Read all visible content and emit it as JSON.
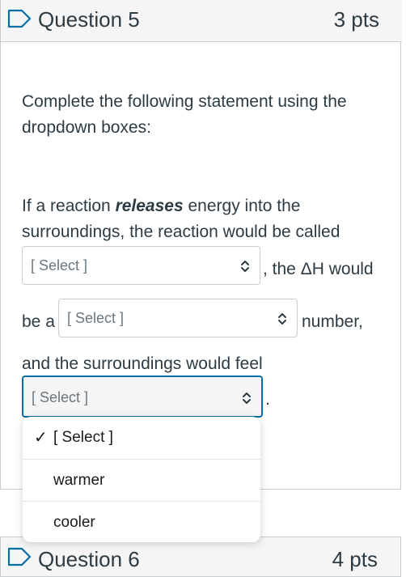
{
  "question5": {
    "title": "Question 5",
    "points": "3 pts",
    "instruction_line1": "Complete the following statement using the",
    "instruction_line2": "dropdown boxes:",
    "stmt_prefix": "If a reaction ",
    "stmt_bold": "releases",
    "stmt_suffix": " energy into the",
    "line2": "surroundings, the reaction would be called",
    "after_select1": ", the ΔH would",
    "be_a": "be a",
    "after_select2": "number,",
    "line5": "and the surroundings would feel",
    "after_select3": ".",
    "select1": {
      "value": "[ Select ]"
    },
    "select2": {
      "value": "[ Select ]"
    },
    "select3": {
      "value": "[ Select ]"
    }
  },
  "dropdown": {
    "check": "✓",
    "options": [
      "[ Select ]",
      "warmer",
      "cooler"
    ],
    "selected_index": 0
  },
  "question6": {
    "title": "Question 6",
    "points": "4 pts"
  },
  "colors": {
    "accent": "#0770a3",
    "text": "#2d3b45",
    "border": "#c7cdd1",
    "header_bg": "#f5f5f5"
  },
  "icons": {
    "flag": "flag-outline-icon",
    "chevron": "chevron-up-down-icon"
  }
}
